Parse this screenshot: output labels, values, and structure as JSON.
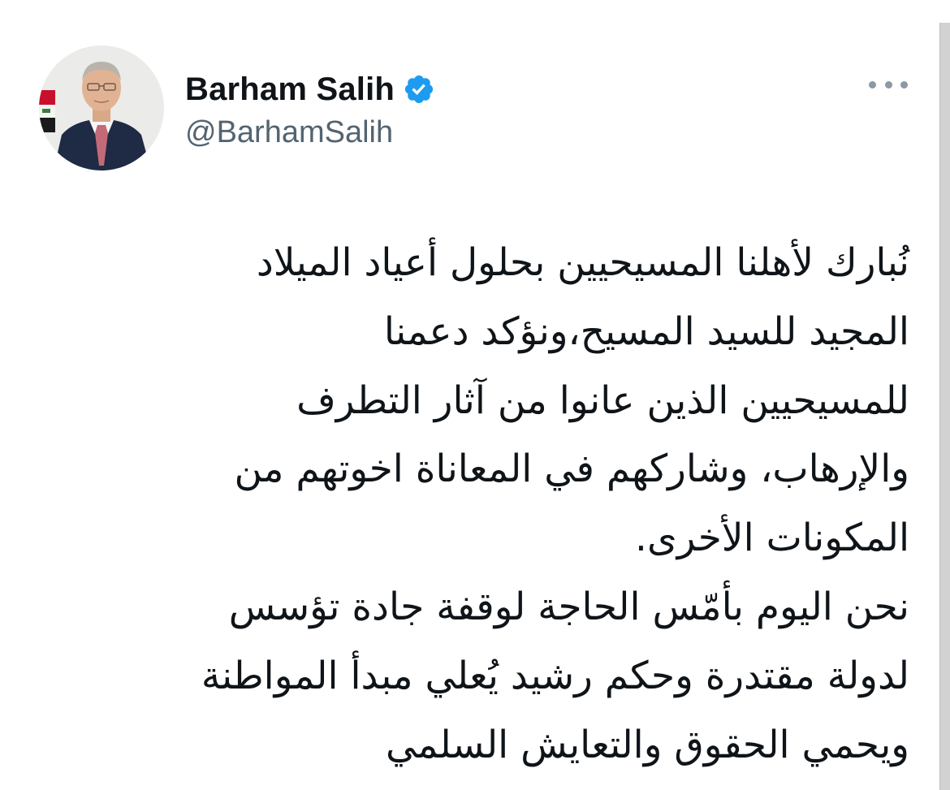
{
  "tweet": {
    "author": {
      "display_name": "Barham Salih",
      "handle": "@BarhamSalih",
      "verified": true,
      "avatar_icon": "profile-photo"
    },
    "more_icon": "more-horizontal-icon",
    "text_lines": [
      "نُبارك لأهلنا المسيحيين بحلول أعياد الميلاد",
      "المجيد للسيد المسيح،ونؤكد دعمنا",
      "للمسيحيين الذين عانوا من آثار التطرف",
      "والإرهاب، وشاركهم في المعاناة اخوتهم من",
      "المكونات الأخرى.",
      "نحن اليوم بأمّس الحاجة لوقفة جادة تؤسس",
      "لدولة مقتدرة وحكم رشيد يُعلي مبدأ المواطنة",
      "ويحمي الحقوق والتعايش السلمي"
    ]
  },
  "colors": {
    "text": "#0f1419",
    "secondary_text": "#536471",
    "verified_blue": "#1d9bf0",
    "more_dots": "#8b98a5"
  }
}
